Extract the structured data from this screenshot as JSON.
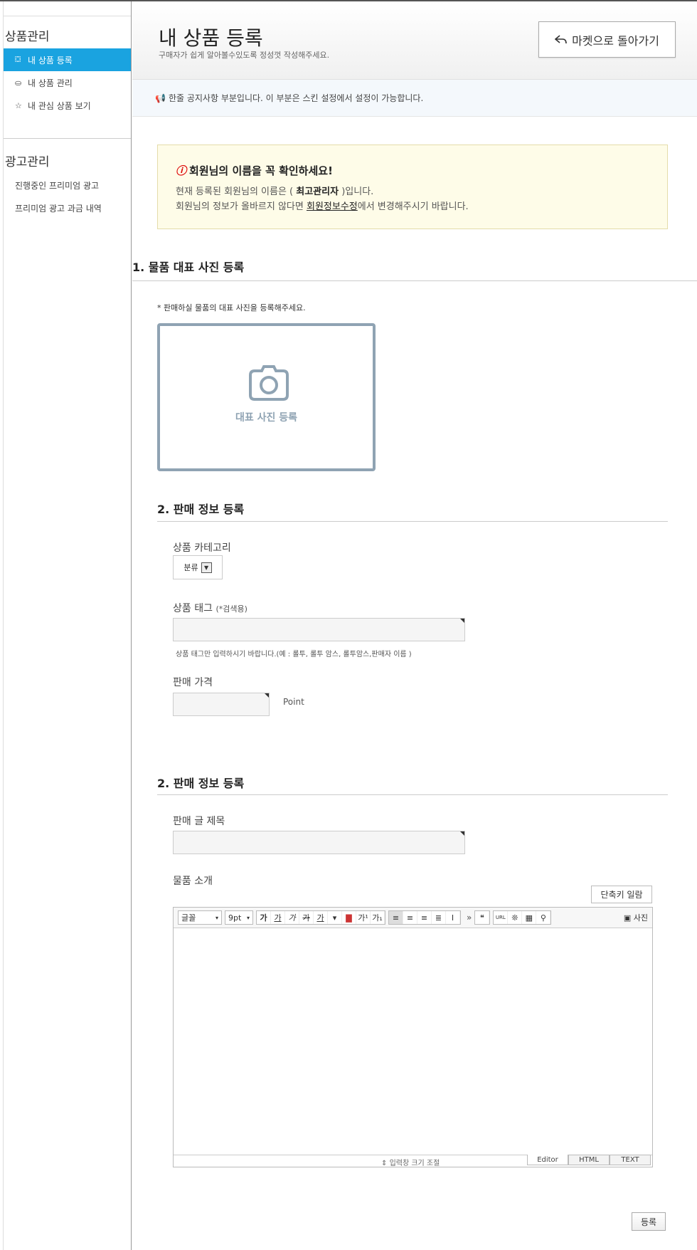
{
  "sidebar": {
    "group1_title": "상품관리",
    "items1": [
      {
        "label": "내 상품 등록",
        "icon": "tag-icon",
        "active": true
      },
      {
        "label": "내 상품 관리",
        "icon": "box-icon",
        "active": false
      },
      {
        "label": "내 관심 상품 보기",
        "icon": "star-icon",
        "active": false
      }
    ],
    "group2_title": "광고관리",
    "items2": [
      {
        "label": "진행중인 프리미엄 광고"
      },
      {
        "label": "프리미엄 광고 과금 내역"
      }
    ]
  },
  "header": {
    "title": "내 상품 등록",
    "subtitle": "구매자가 쉽게 알아볼수있도록 정성껏 작성해주세요.",
    "back_button": "마켓으로 돌아가기"
  },
  "notice": "한줄 공지사항 부분입니다. 이 부분은 스킨 설정에서 설정이 가능합니다.",
  "warning": {
    "title": "회원님의 이름을 꼭 확인하세요!",
    "line1_pre": "현재 등록된 회원님의 이름은 ( ",
    "line1_name": "최고관리자",
    "line1_post": " )입니다.",
    "line2_pre": "회원님의 정보가 올바르지 않다면 ",
    "line2_link": "회원정보수정",
    "line2_post": "에서 변경해주시기 바랍니다."
  },
  "section1": {
    "title": "1. 물품 대표 사진 등록",
    "note": "* 판매하실 물품의 대표 사진을 등록해주세요.",
    "photo_label": "대표 사진 등록"
  },
  "section2": {
    "title": "2. 판매 정보 등록",
    "category_label": "상품 카테고리",
    "category_value": "분류",
    "tag_label": "상품 태그",
    "tag_label_small": "(*검색용)",
    "tag_hint": "상품 태그만 입력하시기 바랍니다.(예 : 롤투, 롤투 암스, 롤투암스,판매자 이름 )",
    "price_label": "판매 가격",
    "price_unit": "Point"
  },
  "section3": {
    "title": "2. 판매 정보 등록",
    "subject_label": "판매 글 제목",
    "desc_label": "물품 소개",
    "shortcut_button": "단축키 일람"
  },
  "editor": {
    "font": "글꼴",
    "size": "9pt",
    "photo": "사진",
    "resize": "입력창 크기 조절",
    "tabs": [
      "Editor",
      "HTML",
      "TEXT"
    ]
  },
  "submit": "등록"
}
